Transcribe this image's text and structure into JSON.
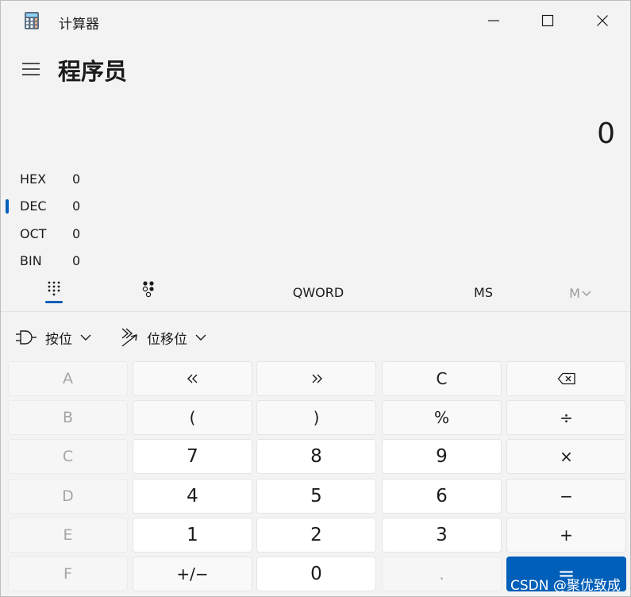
{
  "window": {
    "title": "计算器"
  },
  "header": {
    "mode_title": "程序员"
  },
  "display": {
    "value": "0"
  },
  "bases": [
    {
      "name": "HEX",
      "value": "0",
      "selected": false
    },
    {
      "name": "DEC",
      "value": "0",
      "selected": true
    },
    {
      "name": "OCT",
      "value": "0",
      "selected": false
    },
    {
      "name": "BIN",
      "value": "0",
      "selected": false
    }
  ],
  "modebar": {
    "word_size": "QWORD",
    "memory_store": "MS",
    "memory_list": "M"
  },
  "dropdowns": {
    "bitwise": "按位",
    "bitshift": "位移位"
  },
  "keys": {
    "A": "A",
    "B": "B",
    "C_hex": "C",
    "D": "D",
    "E": "E",
    "F": "F",
    "lsh": "«",
    "rsh": "»",
    "clear": "C",
    "lparen": "(",
    "rparen": ")",
    "percent": "%",
    "n7": "7",
    "n8": "8",
    "n9": "9",
    "n4": "4",
    "n5": "5",
    "n6": "6",
    "n1": "1",
    "n2": "2",
    "n3": "3",
    "negate": "+/−",
    "n0": "0",
    "decimal": ".",
    "divide": "÷",
    "multiply": "×",
    "minus": "−",
    "plus": "+",
    "equals": "="
  },
  "watermark": "CSDN @聚优致成",
  "colors": {
    "accent": "#005fb8",
    "background": "#f3f3f3"
  }
}
